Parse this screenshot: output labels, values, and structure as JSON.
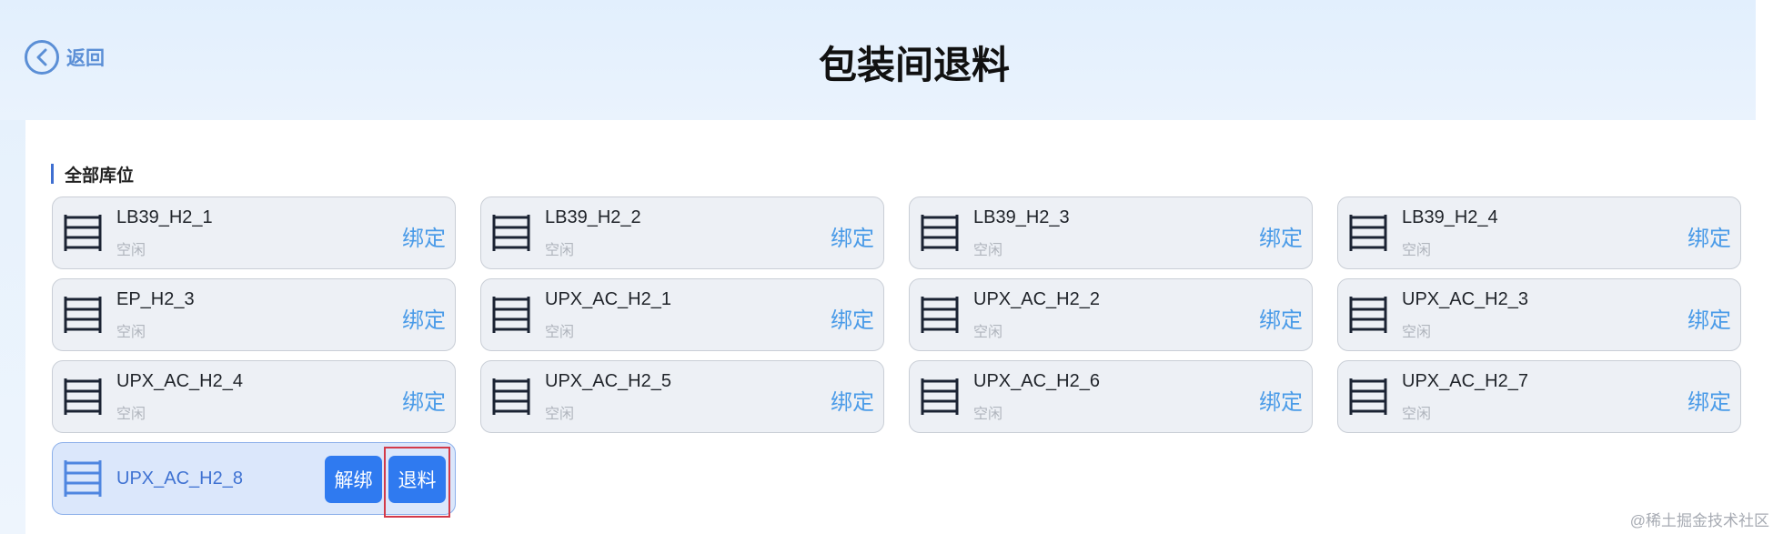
{
  "header": {
    "back_label": "返回",
    "title": "包装间退料"
  },
  "section": {
    "title": "全部库位"
  },
  "locations": [
    {
      "name": "LB39_H2_1",
      "status": "空闲",
      "action": "绑定"
    },
    {
      "name": "LB39_H2_2",
      "status": "空闲",
      "action": "绑定"
    },
    {
      "name": "LB39_H2_3",
      "status": "空闲",
      "action": "绑定"
    },
    {
      "name": "LB39_H2_4",
      "status": "空闲",
      "action": "绑定"
    },
    {
      "name": "EP_H2_3",
      "status": "空闲",
      "action": "绑定"
    },
    {
      "name": "UPX_AC_H2_1",
      "status": "空闲",
      "action": "绑定"
    },
    {
      "name": "UPX_AC_H2_2",
      "status": "空闲",
      "action": "绑定"
    },
    {
      "name": "UPX_AC_H2_3",
      "status": "空闲",
      "action": "绑定"
    },
    {
      "name": "UPX_AC_H2_4",
      "status": "空闲",
      "action": "绑定"
    },
    {
      "name": "UPX_AC_H2_5",
      "status": "空闲",
      "action": "绑定"
    },
    {
      "name": "UPX_AC_H2_6",
      "status": "空闲",
      "action": "绑定"
    },
    {
      "name": "UPX_AC_H2_7",
      "status": "空闲",
      "action": "绑定"
    }
  ],
  "active_location": {
    "name": "UPX_AC_H2_8",
    "unbind_label": "解绑",
    "return_label": "退料"
  },
  "watermark": "@稀土掘金技术社区",
  "colors": {
    "accent": "#2f7af0",
    "bind_text": "#4a9be8",
    "highlight": "#d33a4a"
  }
}
